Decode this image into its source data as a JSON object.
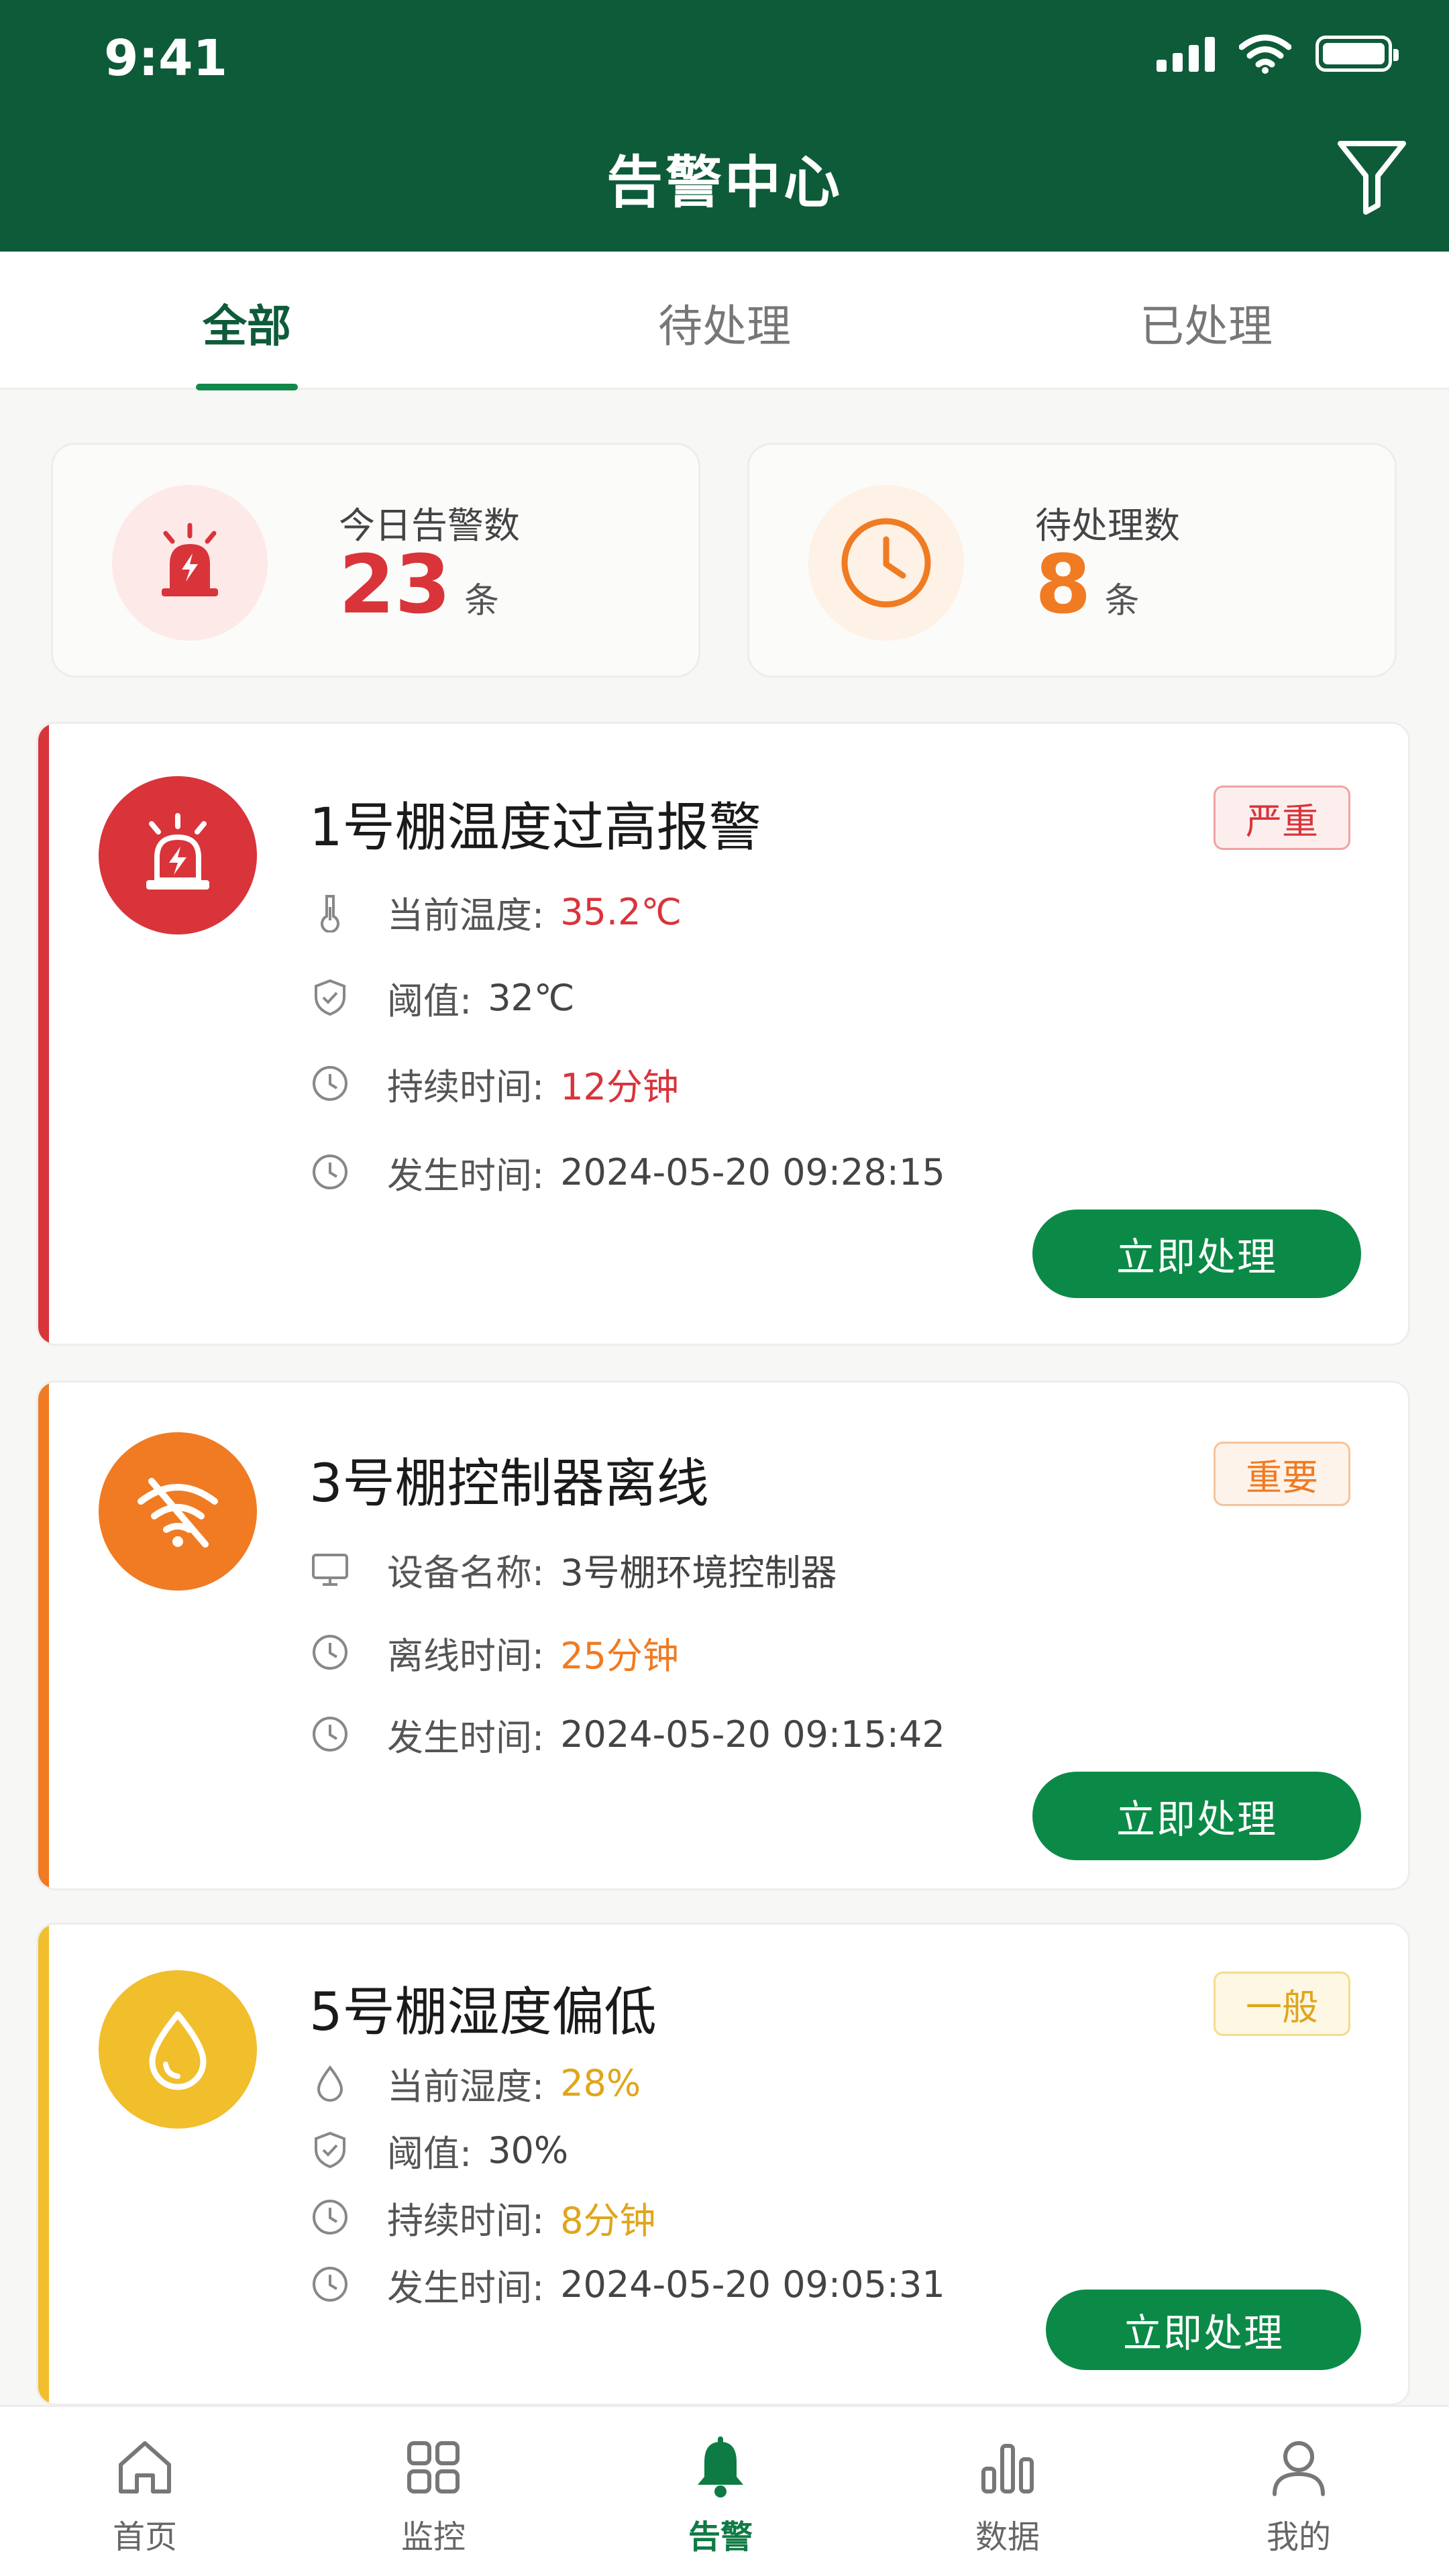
{
  "status_bar": {
    "time": "9:41"
  },
  "header": {
    "title": "告警中心"
  },
  "tabs": [
    {
      "label": "全部",
      "active": true
    },
    {
      "label": "待处理",
      "active": false
    },
    {
      "label": "已处理",
      "active": false
    }
  ],
  "stats": {
    "today": {
      "label": "今日告警数",
      "value": "23",
      "unit": "条",
      "color": "#d9343a"
    },
    "pending": {
      "label": "待处理数",
      "value": "8",
      "unit": "条",
      "color": "#f07b22"
    }
  },
  "alerts": [
    {
      "title": "1号棚温度过高报警",
      "level": "严重",
      "color": "#d9343a",
      "icon": "siren-icon",
      "rows": [
        {
          "icon": "thermometer-icon",
          "label": "当前温度:",
          "value": "35.2℃",
          "highlight": true
        },
        {
          "icon": "shield-check-icon",
          "label": "阈值:",
          "value": "32℃",
          "highlight": false
        },
        {
          "icon": "clock-icon",
          "label": "持续时间:",
          "value": "12分钟",
          "highlight": true
        },
        {
          "icon": "clock-icon",
          "label": "发生时间:",
          "value": "2024-05-20 09:28:15",
          "highlight": false
        }
      ],
      "action": "立即处理"
    },
    {
      "title": "3号棚控制器离线",
      "level": "重要",
      "color": "#f07b22",
      "icon": "wifi-off-icon",
      "rows": [
        {
          "icon": "monitor-icon",
          "label": "设备名称:",
          "value": "3号棚环境控制器",
          "highlight": false
        },
        {
          "icon": "clock-icon",
          "label": "离线时间:",
          "value": "25分钟",
          "highlight": true
        },
        {
          "icon": "clock-icon",
          "label": "发生时间:",
          "value": "2024-05-20 09:15:42",
          "highlight": false
        }
      ],
      "action": "立即处理"
    },
    {
      "title": "5号棚湿度偏低",
      "level": "一般",
      "color": "#f1be2c",
      "icon": "water-drop-icon",
      "rows": [
        {
          "icon": "droplet-icon",
          "label": "当前湿度:",
          "value": "28%",
          "highlight": true
        },
        {
          "icon": "shield-check-icon",
          "label": "阈值:",
          "value": "30%",
          "highlight": false
        },
        {
          "icon": "clock-icon",
          "label": "持续时间:",
          "value": "8分钟",
          "highlight": true
        },
        {
          "icon": "clock-icon",
          "label": "发生时间:",
          "value": "2024-05-20 09:05:31",
          "highlight": false
        }
      ],
      "action": "立即处理"
    }
  ],
  "bottom_nav": [
    {
      "label": "首页",
      "icon": "home-icon",
      "active": false
    },
    {
      "label": "监控",
      "icon": "grid-icon",
      "active": false
    },
    {
      "label": "告警",
      "icon": "bell-icon",
      "active": true
    },
    {
      "label": "数据",
      "icon": "bar-chart-icon",
      "active": false
    },
    {
      "label": "我的",
      "icon": "user-icon",
      "active": false
    }
  ]
}
